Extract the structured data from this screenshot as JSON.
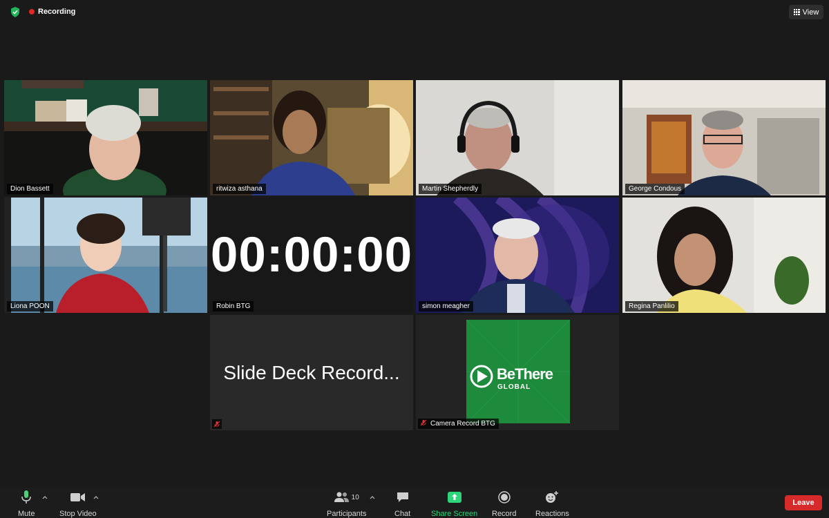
{
  "top": {
    "recording_label": "Recording",
    "view_label": "View"
  },
  "tiles": {
    "dion": {
      "name": "Dion Bassett"
    },
    "ritwiza": {
      "name": "ritwiza asthana",
      "active_speaker": true
    },
    "martin": {
      "name": "Martin Shepherdly"
    },
    "george": {
      "name": "George Condous"
    },
    "liona": {
      "name": "Liona POON"
    },
    "robin": {
      "name": "Robin BTG",
      "timer": "00:00:00"
    },
    "simon": {
      "name": "simon meagher"
    },
    "regina": {
      "name": "Regina Panlilio"
    },
    "slide": {
      "text": "Slide Deck Record..."
    },
    "camera": {
      "name": "Camera Record BTG",
      "logo_line1": "BeThere",
      "logo_line2": "GLOBAL"
    }
  },
  "toolbar": {
    "mute_label": "Mute",
    "video_label": "Stop Video",
    "participants_label": "Participants",
    "participants_count": "10",
    "chat_label": "Chat",
    "share_label": "Share Screen",
    "record_label": "Record",
    "reactions_label": "Reactions",
    "leave_label": "Leave"
  },
  "colors": {
    "active_speaker_border": "#c5e35a",
    "share_green": "#2ed47a",
    "leave_red": "#d72a2a",
    "recording_red": "#e02828"
  },
  "icons": [
    "shield-icon",
    "record-dot-icon",
    "grid-view-icon",
    "microphone-icon",
    "video-camera-icon",
    "participants-icon",
    "chat-bubble-icon",
    "share-screen-icon",
    "record-icon",
    "reactions-icon",
    "muted-mic-icon",
    "play-logo-icon"
  ]
}
